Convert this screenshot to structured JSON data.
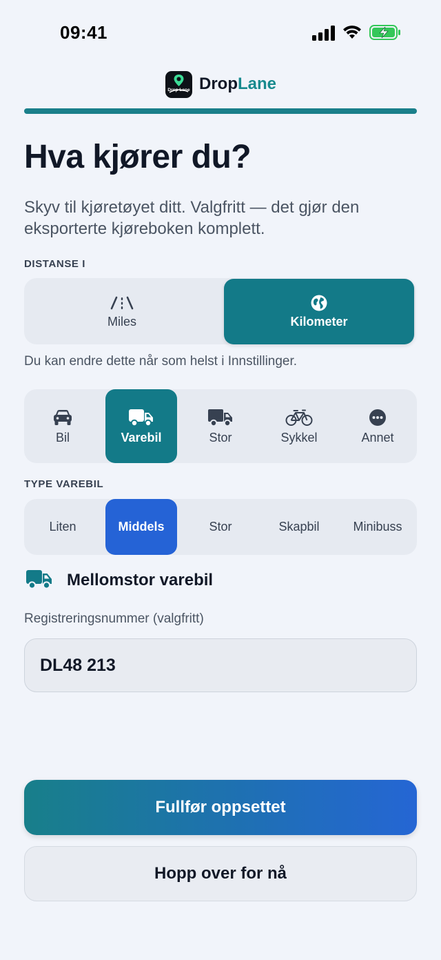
{
  "status_bar": {
    "time": "09:41"
  },
  "brand": {
    "name_part1": "Drop",
    "name_part2": "Lane",
    "accent_color": "#178a8e"
  },
  "progress": {
    "fraction": 1.0,
    "color": "#1a7f8a"
  },
  "header": {
    "title": "Hva kjører du?",
    "subtitle": "Skyv til kjøretøyet ditt. Valgfritt — det gjør den eksporterte kjøreboken komplett."
  },
  "distance": {
    "label": "DISTANSE I",
    "options": [
      {
        "label": "Miles",
        "icon": "road-icon",
        "selected": false
      },
      {
        "label": "Kilometer",
        "icon": "globe-icon",
        "selected": true
      }
    ],
    "hint": "Du kan endre dette når som helst i Innstillinger."
  },
  "vehicles": {
    "options": [
      {
        "label": "Bil",
        "icon": "car-icon",
        "selected": false
      },
      {
        "label": "Varebil",
        "icon": "van-icon",
        "selected": true
      },
      {
        "label": "Stor",
        "icon": "truck-icon",
        "selected": false
      },
      {
        "label": "Sykkel",
        "icon": "bicycle-icon",
        "selected": false
      },
      {
        "label": "Annet",
        "icon": "more-icon",
        "selected": false
      }
    ]
  },
  "van_type": {
    "label": "TYPE VAREBIL",
    "options": [
      {
        "label": "Liten",
        "selected": false
      },
      {
        "label": "Middels",
        "selected": true
      },
      {
        "label": "Stor",
        "selected": false
      },
      {
        "label": "Skapbil",
        "selected": false
      },
      {
        "label": "Minibuss",
        "selected": false
      }
    ]
  },
  "selection": {
    "label": "Mellomstor varebil",
    "icon": "van-icon"
  },
  "registration": {
    "label": "Registreringsnummer (valgfritt)",
    "value": "DL48 213"
  },
  "actions": {
    "primary": "Fullfør oppsettet",
    "secondary": "Hopp over for nå"
  },
  "colors": {
    "teal": "#137a88",
    "blue": "#2563d6",
    "background": "#f1f4fa"
  }
}
